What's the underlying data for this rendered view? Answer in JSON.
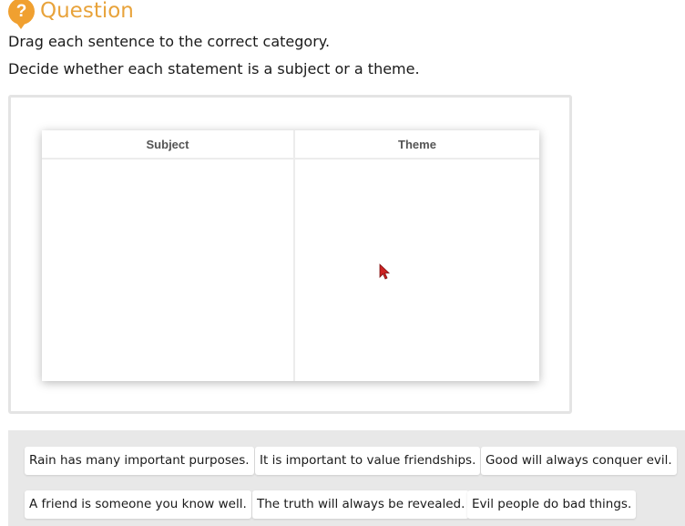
{
  "header": {
    "icon": "question-mark-icon",
    "icon_glyph": "?",
    "title": "Question",
    "accent_color": "#e8a33b"
  },
  "instructions": [
    "Drag each sentence to the correct category.",
    "Decide whether each statement is a subject or a theme."
  ],
  "categories": [
    {
      "label": "Subject"
    },
    {
      "label": "Theme"
    }
  ],
  "cards": [
    "Rain has many important purposes.",
    "It is important to value friendships.",
    "Good will always conquer evil.",
    "A friend is someone you know well.",
    "The truth will always be revealed.",
    "Evil people do bad things."
  ]
}
